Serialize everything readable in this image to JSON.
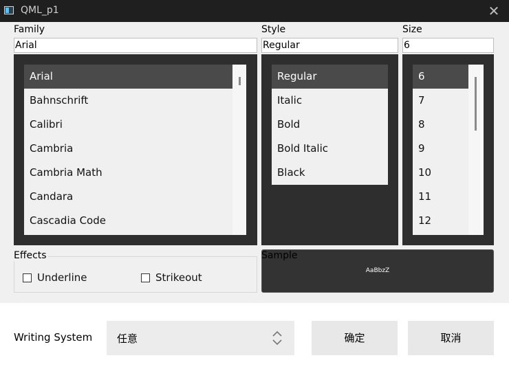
{
  "window": {
    "title": "QML_p1",
    "close_glyph": "✕"
  },
  "family": {
    "label": "Family",
    "value": "Arial",
    "items": [
      "Arial",
      "Bahnschrift",
      "Calibri",
      "Cambria",
      "Cambria Math",
      "Candara",
      "Cascadia Code"
    ],
    "selected_index": 0
  },
  "style": {
    "label": "Style",
    "value": "Regular",
    "items": [
      "Regular",
      "Italic",
      "Bold",
      "Bold Italic",
      "Black"
    ],
    "selected_index": 0
  },
  "size": {
    "label": "Size",
    "value": "6",
    "items": [
      "6",
      "7",
      "8",
      "9",
      "10",
      "11",
      "12"
    ],
    "selected_index": 0
  },
  "effects": {
    "label": "Effects",
    "underline": {
      "label": "Underline",
      "checked": false
    },
    "strikeout": {
      "label": "Strikeout",
      "checked": false
    }
  },
  "sample": {
    "label": "Sample",
    "text": "AaBbzZ"
  },
  "writing_system": {
    "label": "Writing System",
    "value": "任意"
  },
  "buttons": {
    "ok": "确定",
    "cancel": "取消"
  },
  "colors": {
    "titlebar": "#1f1f1f",
    "panel_dark": "#2e2e2e",
    "selection": "#4a4a4a",
    "background": "#f0f0f0"
  },
  "icons": {
    "close": "close-icon",
    "app": "app-icon",
    "spin": "updown-chevron-icon"
  }
}
